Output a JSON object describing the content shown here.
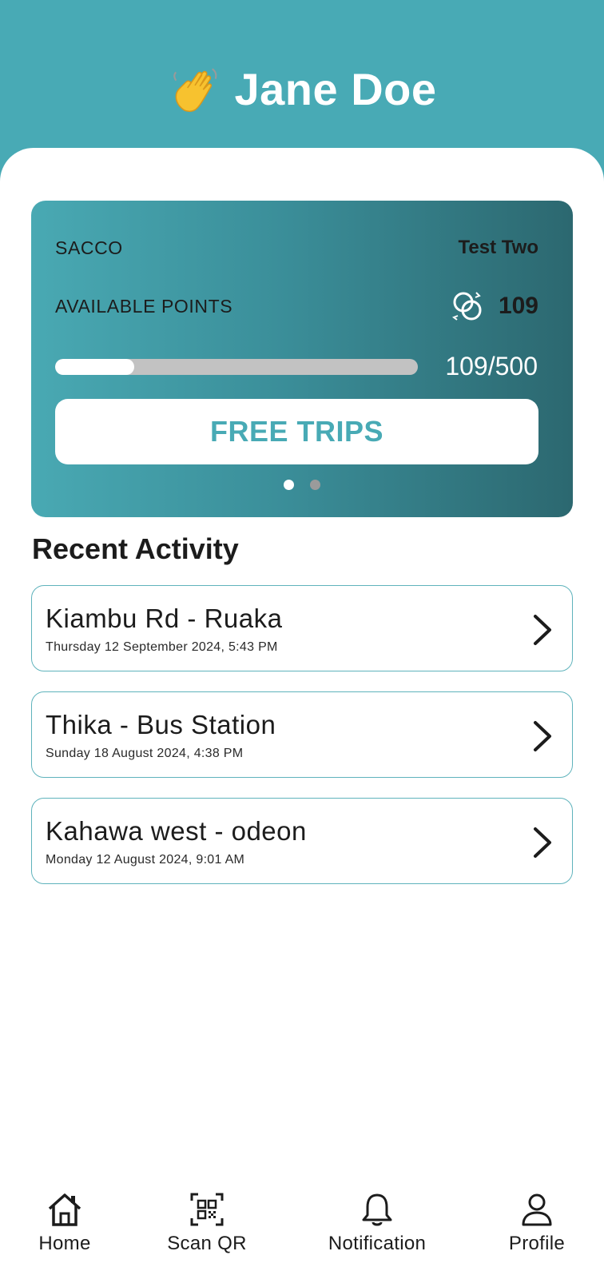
{
  "header": {
    "name": "Jane Doe",
    "icon": "waving-hand-icon"
  },
  "card": {
    "sacco_label": "SACCO",
    "sacco_value": "Test Two",
    "points_label": "AVAILABLE POINTS",
    "points_value": "109",
    "points_icon": "rings-icon",
    "progress_text": "109/500",
    "progress_fraction": 0.218,
    "button_label": "FREE TRIPS",
    "page_count": 2,
    "active_page": 1
  },
  "recent": {
    "title": "Recent Activity",
    "items": [
      {
        "route": "Kiambu Rd - Ruaka",
        "date": "Thursday 12 September 2024, 5:43 PM"
      },
      {
        "route": "Thika - Bus Station",
        "date": "Sunday 18 August 2024, 4:38 PM"
      },
      {
        "route": "Kahawa west - odeon",
        "date": "Monday 12 August 2024, 9:01 AM"
      }
    ]
  },
  "nav": {
    "items": [
      {
        "label": "Home",
        "icon": "home-icon"
      },
      {
        "label": "Scan QR",
        "icon": "qr-code-icon"
      },
      {
        "label": "Notification",
        "icon": "bell-icon"
      },
      {
        "label": "Profile",
        "icon": "user-icon"
      }
    ]
  },
  "colors": {
    "primary": "#48aab5",
    "card_dark": "#2c6870",
    "track": "#c2c2c2"
  }
}
